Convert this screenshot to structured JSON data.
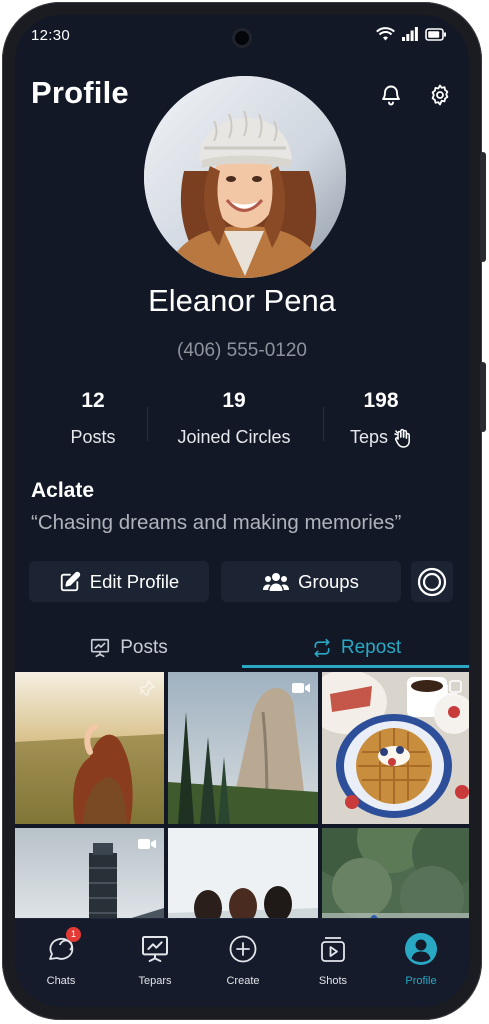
{
  "status_bar": {
    "time": "12:30"
  },
  "header": {
    "title": "Profile",
    "notification_icon": "bell-icon",
    "settings_icon": "gear-icon"
  },
  "profile": {
    "name": "Eleanor Pena",
    "phone": "(406) 555-0120"
  },
  "stats": [
    {
      "value": "12",
      "label": "Posts"
    },
    {
      "value": "19",
      "label": "Joined Circles"
    },
    {
      "value": "198",
      "label": "Teps",
      "icon": "clapping-hand-icon"
    }
  ],
  "bio": {
    "title": "Aclate",
    "quote": "“Chasing dreams and making memories”"
  },
  "actions": {
    "edit_profile": "Edit Profile",
    "groups": "Groups",
    "more_icon": "circle-target-icon"
  },
  "tabs": [
    {
      "label": "Posts",
      "icon": "presentation-icon",
      "active": false
    },
    {
      "label": "Repost",
      "icon": "repost-icon",
      "active": true
    }
  ],
  "grid": [
    {
      "type": "photo",
      "badge": "pin-icon"
    },
    {
      "type": "video",
      "badge": "video-icon"
    },
    {
      "type": "gallery",
      "badge": "multi-image-icon"
    },
    {
      "type": "video",
      "badge": "video-icon"
    },
    {
      "type": "photo",
      "badge": ""
    },
    {
      "type": "photo",
      "badge": ""
    }
  ],
  "bottom_nav": [
    {
      "label": "Chats",
      "icon": "chat-icon",
      "badge": "1",
      "active": false
    },
    {
      "label": "Tepars",
      "icon": "presentation-icon",
      "active": false
    },
    {
      "label": "Create",
      "icon": "plus-circle-icon",
      "active": false
    },
    {
      "label": "Shots",
      "icon": "play-stack-icon",
      "active": false
    },
    {
      "label": "Profile",
      "icon": "user-icon",
      "active": true
    }
  ],
  "colors": {
    "background": "#121826",
    "accent": "#29a8c4",
    "button": "#1c2434",
    "muted_text": "#8e939c",
    "badge": "#e53935"
  }
}
